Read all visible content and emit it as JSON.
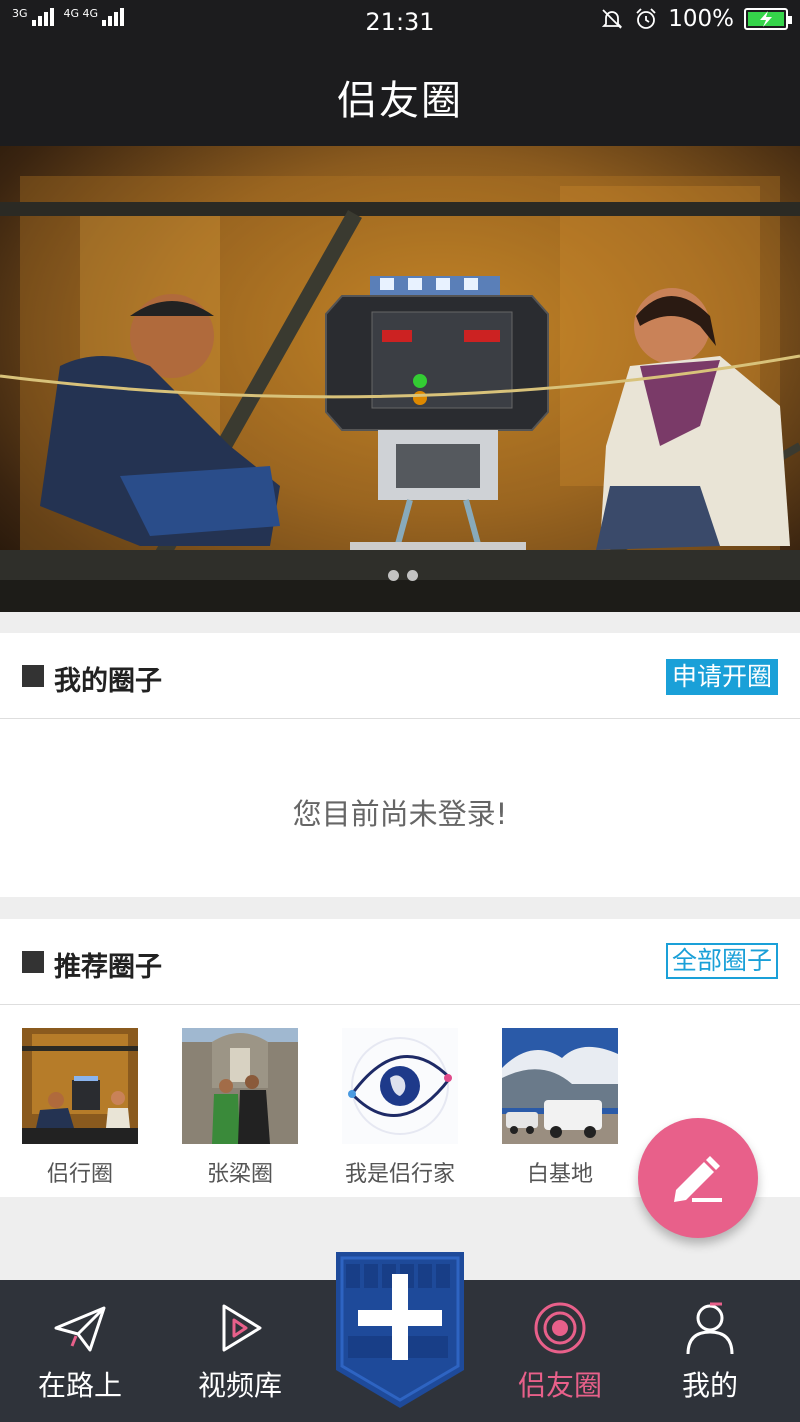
{
  "status_bar": {
    "network_1": "3G",
    "network_2": "4G 4G",
    "time": "21:31",
    "battery": "100%"
  },
  "header": {
    "title": "侣友圈"
  },
  "banner": {
    "slide_count": 2,
    "active_slide": 1
  },
  "my_circles": {
    "title": "我的圈子",
    "action_label": "申请开圈",
    "empty_message": "您目前尚未登录!"
  },
  "recommended": {
    "title": "推荐圈子",
    "action_label": "全部圈子",
    "items": [
      {
        "label": "侣行圈",
        "thumb": "night-stage-photo"
      },
      {
        "label": "张梁圈",
        "thumb": "couple-at-ruins-photo"
      },
      {
        "label": "我是侣行家",
        "thumb": "globe-eye-logo"
      },
      {
        "label": "白基地",
        "thumb": "suv-in-desert-photo"
      }
    ]
  },
  "fab": {
    "icon": "pencil-icon"
  },
  "bottom_nav": {
    "items": [
      {
        "label": "在路上",
        "icon": "paper-plane-icon",
        "active": false
      },
      {
        "label": "视频库",
        "icon": "play-icon",
        "active": false
      },
      {
        "label": "",
        "icon": "plus-badge-icon",
        "active": false
      },
      {
        "label": "侣友圈",
        "icon": "target-icon",
        "active": true
      },
      {
        "label": "我的",
        "icon": "user-icon",
        "active": false
      }
    ]
  },
  "colors": {
    "dark_bar": "#1c1c1e",
    "accent_blue": "#1aa0d8",
    "accent_pink": "#e8608a",
    "nav_bg": "#2f333a"
  }
}
